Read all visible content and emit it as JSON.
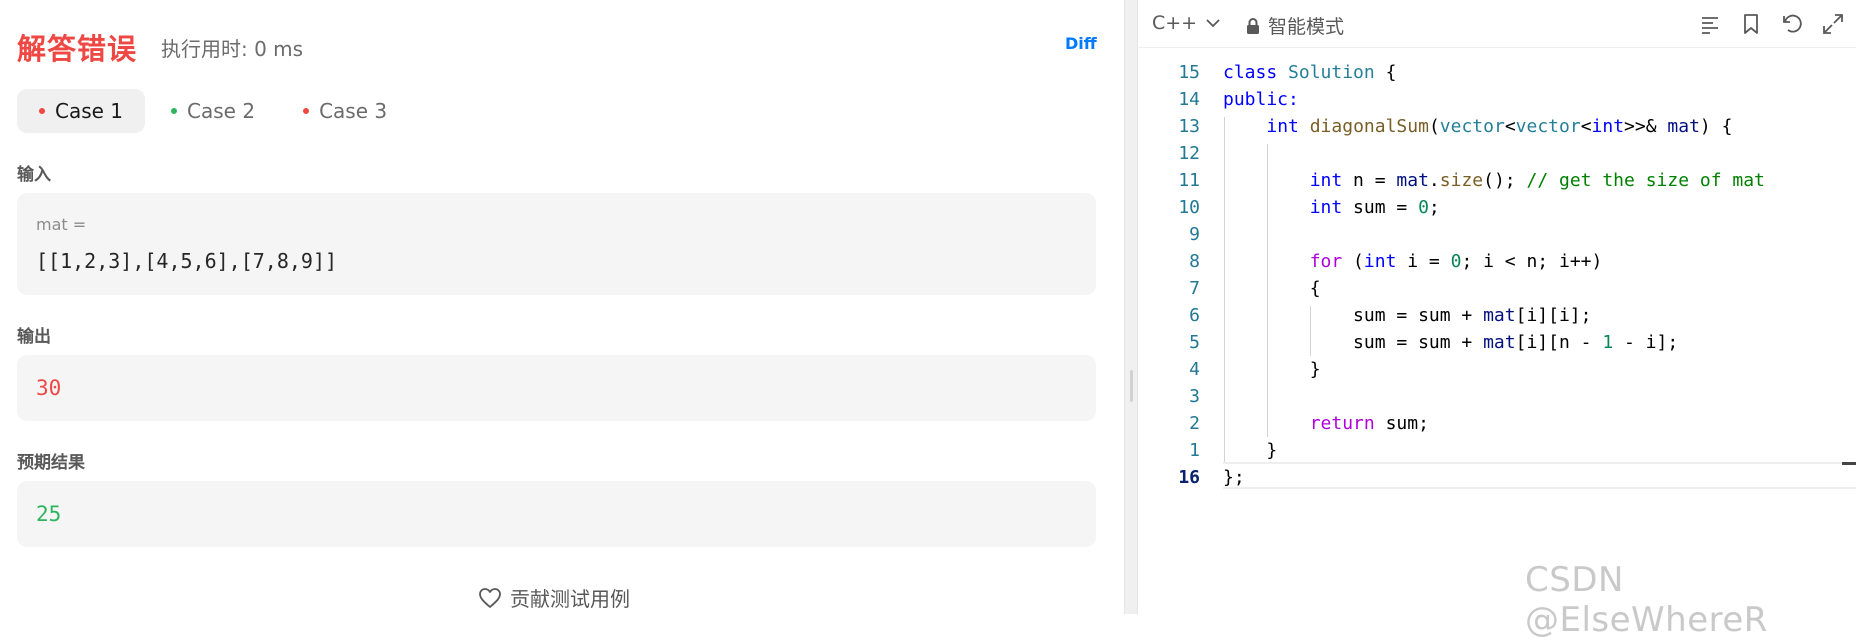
{
  "result": {
    "title": "解答错误",
    "runtime": "执行用时: 0 ms",
    "diff_label": "Diff"
  },
  "cases": [
    {
      "label": "Case 1",
      "status_color": "#ef4743",
      "active": true
    },
    {
      "label": "Case 2",
      "status_color": "#2db55d",
      "active": false
    },
    {
      "label": "Case 3",
      "status_color": "#ef4743",
      "active": false
    }
  ],
  "input": {
    "label": "输入",
    "var_name": "mat =",
    "var_value": "[[1,2,3],[4,5,6],[7,8,9]]"
  },
  "output": {
    "label": "输出",
    "value": "30",
    "color": "#ef4743"
  },
  "expected": {
    "label": "预期结果",
    "value": "25",
    "color": "#2db55d"
  },
  "contribute_label": "贡献测试用例",
  "editor": {
    "language": "C++",
    "mode": "智能模式",
    "icons": [
      "format-icon",
      "bookmark-icon",
      "reset-icon",
      "expand-icon"
    ],
    "line_numbers": [
      "15",
      "14",
      "13",
      "12",
      "11",
      "10",
      "9",
      "8",
      "7",
      "6",
      "5",
      "4",
      "3",
      "2",
      "1",
      "16"
    ],
    "code": {
      "l1_kw": "class",
      "l1_cls": "Solution",
      "l1_rest": " {",
      "l2": "public:",
      "l3_type": "int",
      "l3_fn": "diagonalSum",
      "l3_t1": "vector",
      "l3_t2": "vector",
      "l3_t3": "int",
      "l3_amp": ">>& ",
      "l3_var": "mat",
      "l3_end": ") {",
      "l5_type": "int",
      "l5_a": " n = ",
      "l5_var": "mat",
      "l5_dot": ".",
      "l5_fn": "size",
      "l5_b": "(); ",
      "l5_cmt": "// get the size of mat",
      "l6_type": "int",
      "l6_a": " sum = ",
      "l6_num": "0",
      "l6_b": ";",
      "l8_for": "for",
      "l8_a": " (",
      "l8_type": "int",
      "l8_b": " i = ",
      "l8_num": "0",
      "l8_c": "; i < n; i++)",
      "l9": "{",
      "l10_a": "sum = sum + ",
      "l10_var": "mat",
      "l10_b": "[i][i];",
      "l11_a": "sum = sum + ",
      "l11_var": "mat",
      "l11_b": "[i][n - ",
      "l11_num": "1",
      "l11_c": " - i];",
      "l12": "}",
      "l14_ret": "return",
      "l14_a": " sum;",
      "l15": "}",
      "l16": "};"
    }
  },
  "watermark": "CSDN @ElseWhereR"
}
